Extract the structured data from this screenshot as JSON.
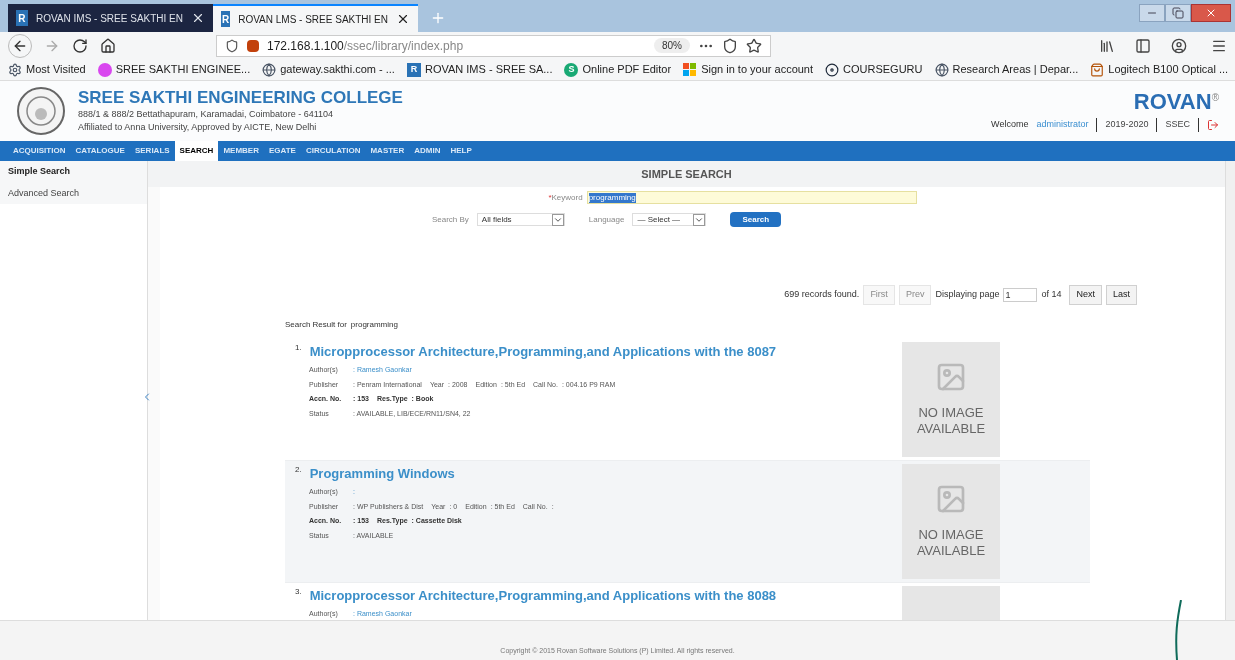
{
  "browser": {
    "tabs": [
      {
        "favicon": "R",
        "title": "ROVAN IMS - SREE SAKTHI EN",
        "selected": false
      },
      {
        "favicon": "R",
        "title": "ROVAN LMS - SREE SAKTHI EN",
        "selected": true
      }
    ],
    "url": {
      "host": "172.168.1.100",
      "path": "/ssec/library/index.php"
    },
    "zoom": "80%",
    "bookmarks": [
      {
        "kind": "gear",
        "label": "Most Visited"
      },
      {
        "kind": "college",
        "label": "SREE SAKTHI ENGINEE..."
      },
      {
        "kind": "globe",
        "label": "gateway.sakthi.com - ..."
      },
      {
        "kind": "rovan",
        "label": "ROVAN IMS - SREE SA...",
        "glyph": "R"
      },
      {
        "kind": "pdf",
        "label": "Online PDF Editor",
        "glyph": "S"
      },
      {
        "kind": "windows",
        "label": "Sign in to your account"
      },
      {
        "kind": "disc",
        "label": "COURSEGURU"
      },
      {
        "kind": "globe",
        "label": "Research Areas | Depar..."
      },
      {
        "kind": "bag",
        "label": "Logitech B100 Optical ..."
      }
    ]
  },
  "header": {
    "college": "SREE SAKTHI ENGINEERING COLLEGE",
    "address": "888/1 & 888/2 Bettathapuram, Karamadai, Coimbatore - 641104",
    "affiliation": "Affiliated to Anna University, Approved by AICTE, New Delhi",
    "brand": "ROVAN",
    "brand_mark": "®",
    "welcome": "Welcome",
    "user": "administrator",
    "year": "2019-2020",
    "code": "SSEC"
  },
  "nav": [
    {
      "label": "ACQUISITION",
      "selected": false
    },
    {
      "label": "CATALOGUE",
      "selected": false
    },
    {
      "label": "SERIALS",
      "selected": false
    },
    {
      "label": "SEARCH",
      "selected": true
    },
    {
      "label": "MEMBER",
      "selected": false
    },
    {
      "label": "EGATE",
      "selected": false
    },
    {
      "label": "CIRCULATION",
      "selected": false
    },
    {
      "label": "MASTER",
      "selected": false
    },
    {
      "label": "ADMIN",
      "selected": false
    },
    {
      "label": "HELP",
      "selected": false
    }
  ],
  "sidebar": [
    {
      "label": "Simple Search",
      "selected": true
    },
    {
      "label": "Advanced Search",
      "selected": false
    }
  ],
  "search": {
    "title": "SIMPLE SEARCH",
    "required_mark": "*",
    "keyword_label": "Keyword",
    "keyword": "programming",
    "search_by_label": "Search By",
    "search_by": "All fields",
    "language_label": "Language",
    "language": "— Select —",
    "button": "Search"
  },
  "pagination": {
    "count": "699 records found.",
    "first": {
      "label": "First",
      "disabled": true
    },
    "prev": {
      "label": "Prev",
      "disabled": true
    },
    "displaying": "Displaying page",
    "page": "1",
    "of": "of 14",
    "next": {
      "label": "Next",
      "disabled": false
    },
    "last": {
      "label": "Last",
      "disabled": false
    }
  },
  "results_heading": {
    "label": "Search Result for",
    "query": "programming"
  },
  "results": [
    {
      "number": "1.",
      "title": "Micropprocessor Architecture,Programming,and Applications with the 8087",
      "shaded": false,
      "image_caption": "NO IMAGE AVAILABLE",
      "lines": [
        [
          {
            "label": "Author(s)",
            "value": ": Ramesh Gaonkar",
            "kind": "link",
            "bold": false
          }
        ],
        [
          {
            "label": "Publisher",
            "value": ": Penram International",
            "kind": "text",
            "bold": false
          },
          {
            "label": "Year",
            "value": ": 2008",
            "kind": "text",
            "bold": false
          },
          {
            "label": "Edition",
            "value": ": 5th Ed",
            "kind": "text",
            "bold": false
          },
          {
            "label": "Call No.",
            "value": ": 004.16 P9 RAM",
            "kind": "text",
            "bold": false
          }
        ],
        [
          {
            "label": "Accn. No.",
            "value": ": 153",
            "kind": "text",
            "bold": true
          },
          {
            "label": "Res.Type",
            "value": ": Book",
            "kind": "text",
            "bold": true
          }
        ],
        [
          {
            "label": "Status",
            "value": ": AVAILABLE, LIB/ECE/RN11/SN4, 22",
            "kind": "text",
            "bold": false
          }
        ]
      ]
    },
    {
      "number": "2.",
      "title": "Programming Windows",
      "shaded": true,
      "image_caption": "NO IMAGE AVAILABLE",
      "lines": [
        [
          {
            "label": "Author(s)",
            "value": ":",
            "kind": "link",
            "bold": false
          }
        ],
        [
          {
            "label": "Publisher",
            "value": ": WP Publishers & Dist",
            "kind": "text",
            "bold": false
          },
          {
            "label": "Year",
            "value": ": 0",
            "kind": "text",
            "bold": false
          },
          {
            "label": "Edition",
            "value": ": 5th Ed",
            "kind": "text",
            "bold": false
          },
          {
            "label": "Call No.",
            "value": ":",
            "kind": "text",
            "bold": false
          }
        ],
        [
          {
            "label": "Accn. No.",
            "value": ": 153",
            "kind": "text",
            "bold": true
          },
          {
            "label": "Res.Type",
            "value": ": Cassette Disk",
            "kind": "text",
            "bold": true
          }
        ],
        [
          {
            "label": "Status",
            "value": ": AVAILABLE",
            "kind": "text",
            "bold": false
          }
        ]
      ]
    },
    {
      "number": "3.",
      "title": "Micropprocessor Architecture,Programming,and Applications with the 8088",
      "shaded": false,
      "lines": [
        [
          {
            "label": "Author(s)",
            "value": ": Ramesh Gaonkar",
            "kind": "link",
            "bold": false
          }
        ]
      ]
    }
  ],
  "footer": "Copyright © 2015 Rovan Software Solutions (P) Limited. All rights reserved."
}
